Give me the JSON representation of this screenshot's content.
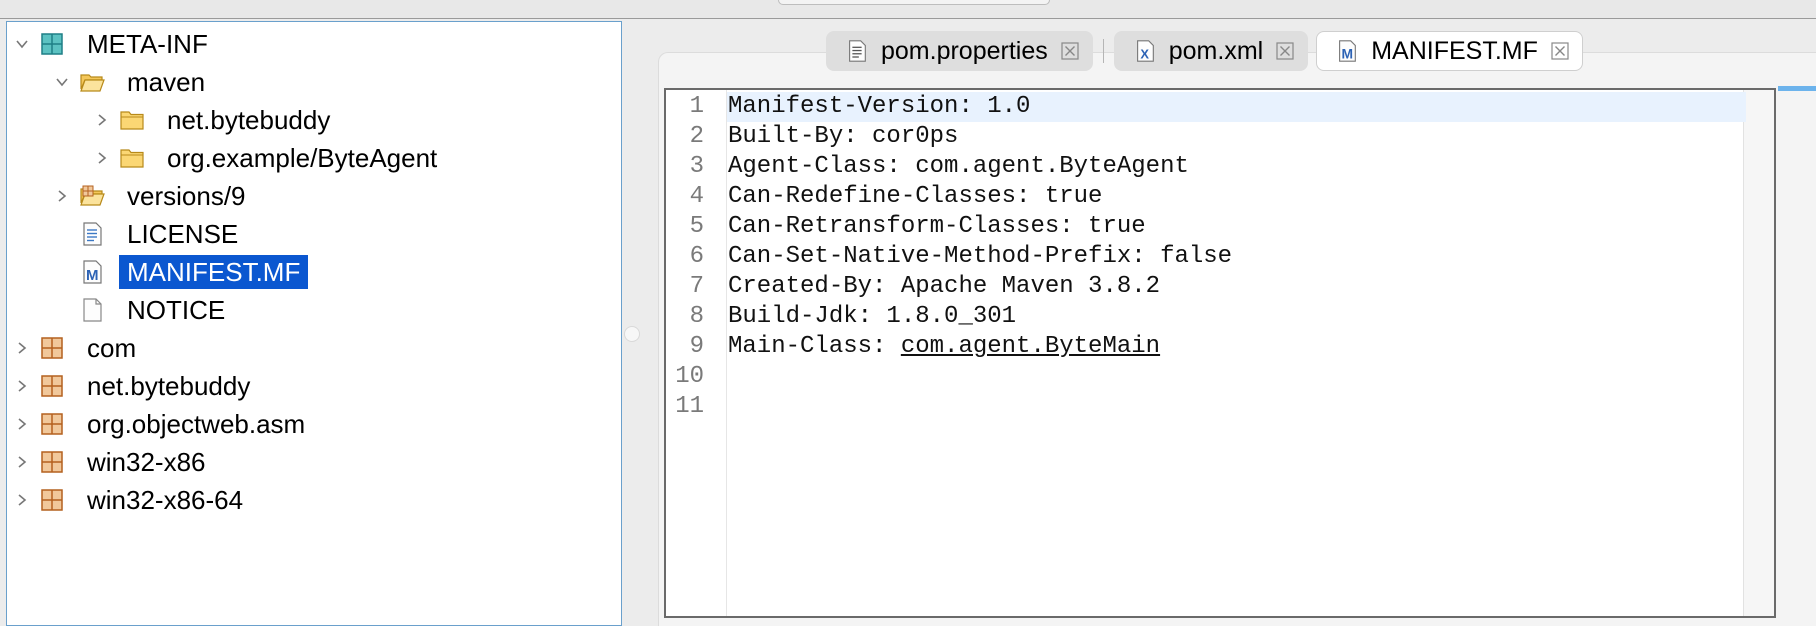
{
  "tree": [
    {
      "label": "META-INF",
      "expanded": true,
      "icon": "package-open-icon"
    },
    {
      "label": "maven",
      "expanded": true,
      "icon": "folder-open-icon"
    },
    {
      "label": "net.bytebuddy",
      "expanded": false,
      "icon": "folder-icon"
    },
    {
      "label": "org.example/ByteAgent",
      "expanded": false,
      "icon": "folder-icon"
    },
    {
      "label": "versions/9",
      "expanded": false,
      "icon": "folder-package-icon"
    },
    {
      "label": "LICENSE",
      "icon": "text-file-icon"
    },
    {
      "label": "MANIFEST.MF",
      "icon": "manifest-file-icon",
      "selected": true
    },
    {
      "label": "NOTICE",
      "icon": "file-icon"
    },
    {
      "label": "com",
      "expanded": false,
      "icon": "package-icon"
    },
    {
      "label": "net.bytebuddy",
      "expanded": false,
      "icon": "package-icon"
    },
    {
      "label": "org.objectweb.asm",
      "expanded": false,
      "icon": "package-icon"
    },
    {
      "label": "win32-x86",
      "expanded": false,
      "icon": "package-icon"
    },
    {
      "label": "win32-x86-64",
      "expanded": false,
      "icon": "package-icon"
    }
  ],
  "tabs": [
    {
      "label": "pom.properties",
      "icon": "properties-file-icon",
      "active": false
    },
    {
      "label": "pom.xml",
      "icon": "xml-file-icon",
      "active": false
    },
    {
      "label": "MANIFEST.MF",
      "icon": "manifest-file-icon",
      "active": true
    }
  ],
  "editor": {
    "current_line": 1,
    "lines": [
      {
        "num": "1",
        "text": "Manifest-Version: 1.0"
      },
      {
        "num": "2",
        "text": "Built-By: cor0ps"
      },
      {
        "num": "3",
        "text": "Agent-Class: com.agent.ByteAgent"
      },
      {
        "num": "4",
        "text": "Can-Redefine-Classes: true"
      },
      {
        "num": "5",
        "text": "Can-Retransform-Classes: true"
      },
      {
        "num": "6",
        "text": "Can-Set-Native-Method-Prefix: false"
      },
      {
        "num": "7",
        "text": "Created-By: Apache Maven 3.8.2"
      },
      {
        "num": "8",
        "text": "Build-Jdk: 1.8.0_301"
      },
      {
        "num": "9",
        "text": "Main-Class: ",
        "link": "com.agent.ByteMain"
      },
      {
        "num": "10",
        "text": ""
      },
      {
        "num": "11",
        "text": ""
      }
    ]
  },
  "colors": {
    "selection": "#0b57d0",
    "current_line": "#e8f2fe",
    "tree_border": "#6aa0cc",
    "package_icon": "#c96a1e"
  }
}
